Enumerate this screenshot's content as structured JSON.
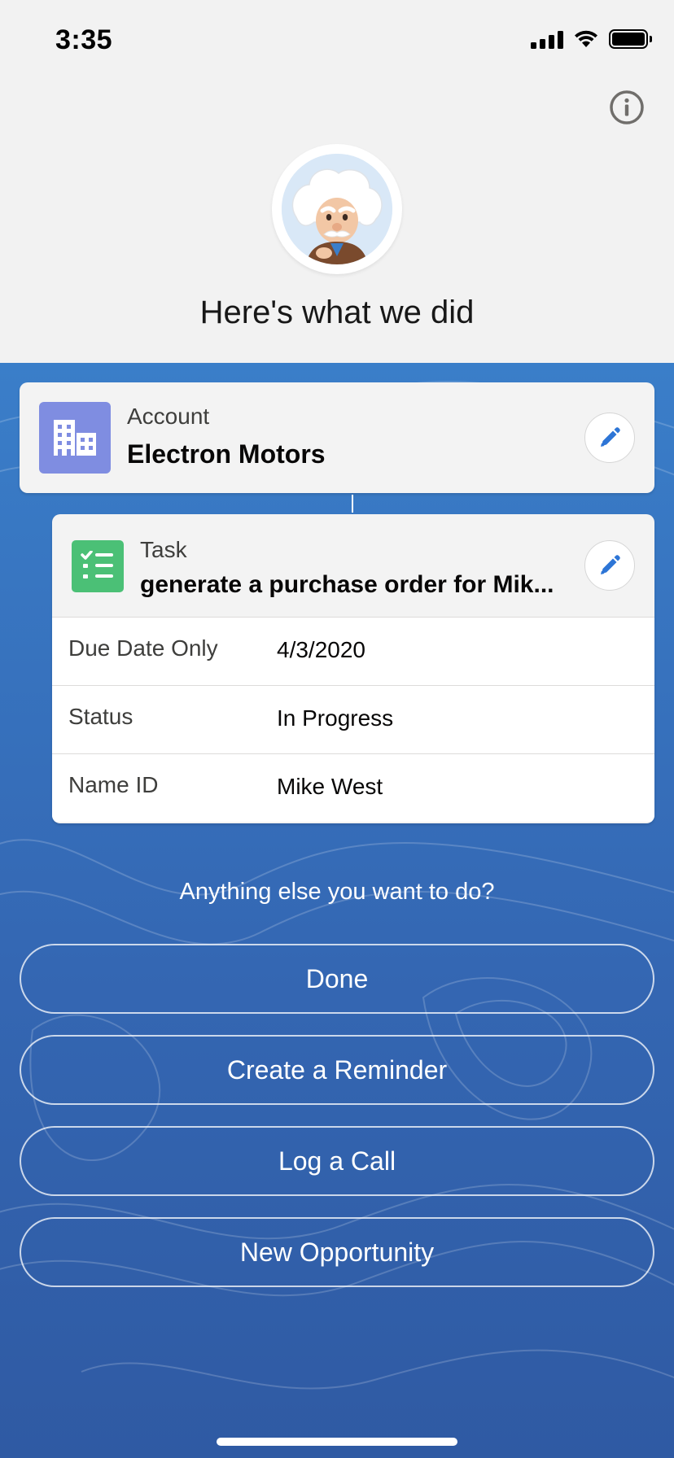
{
  "status_bar": {
    "time": "3:35",
    "icons": [
      "cellular-signal-icon",
      "wifi-icon",
      "battery-icon"
    ]
  },
  "header": {
    "info_icon": "info-icon",
    "avatar": "einstein-avatar",
    "title": "Here's what we did"
  },
  "account": {
    "type_label": "Account",
    "name": "Electron Motors",
    "icon": "building-icon",
    "icon_color": "#7f8de1",
    "edit_icon": "pencil-icon"
  },
  "task": {
    "type_label": "Task",
    "name": "generate a purchase order for Mik...",
    "icon": "task-list-icon",
    "icon_color": "#4bc076",
    "edit_icon": "pencil-icon",
    "fields": [
      {
        "label": "Due Date Only",
        "value": "4/3/2020"
      },
      {
        "label": "Status",
        "value": "In Progress"
      },
      {
        "label": "Name ID",
        "value": "Mike West"
      }
    ]
  },
  "prompt": "Anything else you want to do?",
  "actions": [
    "Done",
    "Create a Reminder",
    "Log a Call",
    "New Opportunity"
  ],
  "colors": {
    "accent_blue": "#3a7ec9",
    "edit_icon_blue": "#2d75d6"
  }
}
